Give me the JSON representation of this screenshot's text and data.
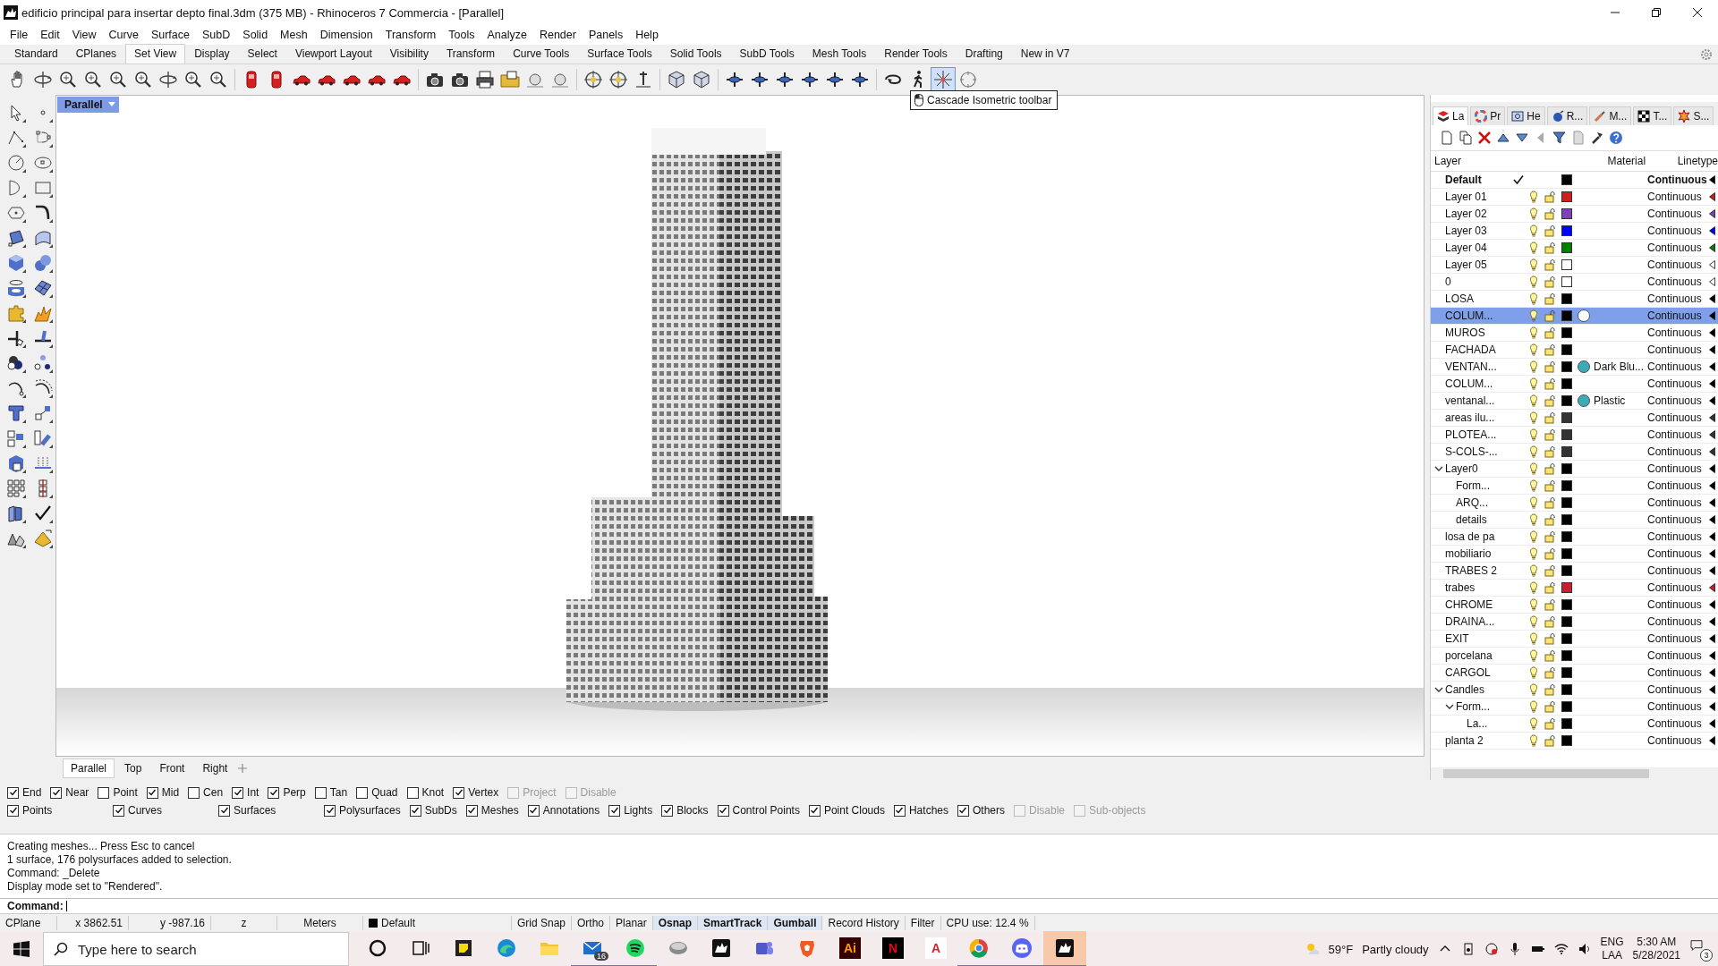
{
  "window": {
    "title": "edificio principal para insertar depto final.3dm (375 MB) - Rhinoceros 7 Commercia - [Parallel]"
  },
  "menu": [
    "File",
    "Edit",
    "View",
    "Curve",
    "Surface",
    "SubD",
    "Solid",
    "Mesh",
    "Dimension",
    "Transform",
    "Tools",
    "Analyze",
    "Render",
    "Panels",
    "Help"
  ],
  "toolbar_tabs": [
    {
      "label": "Standard",
      "selected": false
    },
    {
      "label": "CPlanes",
      "selected": false
    },
    {
      "label": "Set View",
      "selected": true
    },
    {
      "label": "Display",
      "selected": false
    },
    {
      "label": "Select",
      "selected": false
    },
    {
      "label": "Viewport Layout",
      "selected": false
    },
    {
      "label": "Visibility",
      "selected": false
    },
    {
      "label": "Transform",
      "selected": false
    },
    {
      "label": "Curve Tools",
      "selected": false
    },
    {
      "label": "Surface Tools",
      "selected": false
    },
    {
      "label": "Solid Tools",
      "selected": false
    },
    {
      "label": "SubD Tools",
      "selected": false
    },
    {
      "label": "Mesh Tools",
      "selected": false
    },
    {
      "label": "Render Tools",
      "selected": false
    },
    {
      "label": "Drafting",
      "selected": false
    },
    {
      "label": "New in V7",
      "selected": false
    }
  ],
  "toolbar": {
    "buttons": [
      {
        "kind": "hand",
        "selected": false
      },
      {
        "kind": "rotate",
        "selected": false
      },
      {
        "kind": "zoom",
        "selected": false
      },
      {
        "kind": "zoom",
        "selected": false
      },
      {
        "kind": "zoom",
        "selected": false
      },
      {
        "kind": "zoom",
        "selected": false
      },
      {
        "kind": "rotate",
        "selected": false
      },
      {
        "kind": "zoom",
        "selected": false
      },
      {
        "kind": "zoom",
        "selected": false
      },
      {
        "kind": "sep"
      },
      {
        "kind": "red",
        "selected": false
      },
      {
        "kind": "red",
        "selected": false
      },
      {
        "kind": "car",
        "selected": false
      },
      {
        "kind": "car",
        "selected": false
      },
      {
        "kind": "car",
        "selected": false
      },
      {
        "kind": "car",
        "selected": false
      },
      {
        "kind": "car",
        "selected": false
      },
      {
        "kind": "sep"
      },
      {
        "kind": "camera",
        "selected": false
      },
      {
        "kind": "camera",
        "selected": false
      },
      {
        "kind": "printer",
        "selected": false
      },
      {
        "kind": "folder",
        "selected": false
      },
      {
        "kind": "sphere",
        "selected": false
      },
      {
        "kind": "sphere",
        "selected": false
      },
      {
        "kind": "sep"
      },
      {
        "kind": "target",
        "selected": false
      },
      {
        "kind": "target",
        "selected": false
      },
      {
        "kind": "pin",
        "selected": false
      },
      {
        "kind": "sep"
      },
      {
        "kind": "box",
        "selected": false
      },
      {
        "kind": "box",
        "selected": false
      },
      {
        "kind": "sep"
      },
      {
        "kind": "plane",
        "selected": false
      },
      {
        "kind": "plane",
        "selected": false
      },
      {
        "kind": "plane",
        "selected": false
      },
      {
        "kind": "plane",
        "selected": false
      },
      {
        "kind": "plane",
        "selected": false
      },
      {
        "kind": "plane",
        "selected": false
      },
      {
        "kind": "sep"
      },
      {
        "kind": "loop",
        "selected": false
      },
      {
        "kind": "walk",
        "selected": false
      },
      {
        "kind": "iso",
        "selected": true
      },
      {
        "kind": "dial",
        "selected": false
      }
    ]
  },
  "tooltip": "Cascade Isometric toolbar",
  "viewport": {
    "label": "Parallel",
    "tabs": [
      {
        "label": "Parallel",
        "selected": true
      },
      {
        "label": "Top",
        "selected": false
      },
      {
        "label": "Front",
        "selected": false
      },
      {
        "label": "Right",
        "selected": false
      }
    ]
  },
  "layers_panel": {
    "tabs": [
      {
        "label": "La",
        "kind": "layers",
        "selected": true
      },
      {
        "label": "Pr",
        "kind": "properties",
        "selected": false
      },
      {
        "label": "He",
        "kind": "help",
        "selected": false
      },
      {
        "label": "R...",
        "kind": "render",
        "selected": false
      },
      {
        "label": "M...",
        "kind": "materials",
        "selected": false
      },
      {
        "label": "T...",
        "kind": "textures",
        "selected": false
      },
      {
        "label": "S...",
        "kind": "sun",
        "selected": false
      }
    ],
    "columns": [
      "Layer",
      "Material",
      "Linetype"
    ],
    "layers": [
      {
        "name": "Default",
        "current": true,
        "selected": false,
        "color": "#000000",
        "linetype": "Continuous"
      },
      {
        "name": "Layer 01",
        "current": false,
        "selected": false,
        "color": "#cc1f1f",
        "linetype": "Continuous"
      },
      {
        "name": "Layer 02",
        "current": false,
        "selected": false,
        "color": "#7f3fbf",
        "linetype": "Continuous"
      },
      {
        "name": "Layer 03",
        "current": false,
        "selected": false,
        "color": "#0000ff",
        "linetype": "Continuous"
      },
      {
        "name": "Layer 04",
        "current": false,
        "selected": false,
        "color": "#007f00",
        "linetype": "Continuous"
      },
      {
        "name": "Layer 05",
        "current": false,
        "selected": false,
        "color": "#ffffff",
        "linetype": "Continuous"
      },
      {
        "name": "0",
        "current": false,
        "selected": false,
        "color": "#ffffff",
        "linetype": "Continuous"
      },
      {
        "name": "LOSA",
        "current": false,
        "selected": false,
        "color": "#000000",
        "linetype": "Continuous"
      },
      {
        "name": "COLUM...",
        "current": false,
        "selected": true,
        "color": "#000000",
        "material": {
          "color": "#ffffff"
        },
        "linetype": "Continuous"
      },
      {
        "name": "MUROS",
        "current": false,
        "selected": false,
        "color": "#000000",
        "linetype": "Continuous"
      },
      {
        "name": "FACHADA",
        "current": false,
        "selected": false,
        "color": "#000000",
        "linetype": "Continuous"
      },
      {
        "name": "VENTAN...",
        "current": false,
        "selected": false,
        "color": "#000000",
        "material": {
          "name": "Dark Blu...",
          "color": "#3fa9b5"
        },
        "linetype": "Continuous"
      },
      {
        "name": "COLUM...",
        "current": false,
        "selected": false,
        "color": "#000000",
        "linetype": "Continuous"
      },
      {
        "name": "ventanal...",
        "current": false,
        "selected": false,
        "color": "#000000",
        "material": {
          "name": "Plastic",
          "color": "#3fa9b5"
        },
        "linetype": "Continuous"
      },
      {
        "name": "areas ilu...",
        "current": false,
        "selected": false,
        "color": "#333333",
        "linetype": "Continuous"
      },
      {
        "name": "PLOTEA...",
        "current": false,
        "selected": false,
        "color": "#333333",
        "linetype": "Continuous"
      },
      {
        "name": "S-COLS-...",
        "current": false,
        "selected": false,
        "color": "#333333",
        "linetype": "Continuous"
      },
      {
        "name": "Layer0",
        "current": false,
        "selected": false,
        "color": "#000000",
        "linetype": "Continuous",
        "expanded": true,
        "children": [
          {
            "name": "Form...",
            "current": false,
            "selected": false,
            "color": "#000000",
            "linetype": "Continuous"
          },
          {
            "name": "ARQ...",
            "current": false,
            "selected": false,
            "color": "#000000",
            "linetype": "Continuous"
          },
          {
            "name": "details",
            "current": false,
            "selected": false,
            "color": "#000000",
            "linetype": "Continuous"
          }
        ]
      },
      {
        "name": "losa de pa",
        "current": false,
        "selected": false,
        "color": "#000000",
        "linetype": "Continuous"
      },
      {
        "name": "mobiliario",
        "current": false,
        "selected": false,
        "color": "#000000",
        "linetype": "Continuous"
      },
      {
        "name": "TRABES 2",
        "current": false,
        "selected": false,
        "color": "#000000",
        "linetype": "Continuous"
      },
      {
        "name": "trabes",
        "current": false,
        "selected": false,
        "color": "#c81e32",
        "linetype": "Continuous"
      },
      {
        "name": "CHROME",
        "current": false,
        "selected": false,
        "color": "#000000",
        "linetype": "Continuous"
      },
      {
        "name": "DRAINA...",
        "current": false,
        "selected": false,
        "color": "#000000",
        "linetype": "Continuous"
      },
      {
        "name": "EXIT",
        "current": false,
        "selected": false,
        "color": "#000000",
        "linetype": "Continuous"
      },
      {
        "name": "porcelana",
        "current": false,
        "selected": false,
        "color": "#000000",
        "linetype": "Continuous"
      },
      {
        "name": "CARGOL",
        "current": false,
        "selected": false,
        "color": "#000000",
        "linetype": "Continuous"
      },
      {
        "name": "Candles",
        "current": false,
        "selected": false,
        "color": "#000000",
        "linetype": "Continuous",
        "expanded": true,
        "children": [
          {
            "name": "Form...",
            "current": false,
            "selected": false,
            "color": "#000000",
            "linetype": "Continuous",
            "expanded": true,
            "children": [
              {
                "name": "La...",
                "current": false,
                "selected": false,
                "color": "#000000",
                "linetype": "Continuous"
              }
            ]
          }
        ]
      },
      {
        "name": "planta 2",
        "current": false,
        "selected": false,
        "color": "#000000",
        "linetype": "Continuous"
      }
    ]
  },
  "osnaps": [
    {
      "label": "End",
      "checked": true,
      "disabled": false
    },
    {
      "label": "Near",
      "checked": true,
      "disabled": false
    },
    {
      "label": "Point",
      "checked": false,
      "disabled": false
    },
    {
      "label": "Mid",
      "checked": true,
      "disabled": false
    },
    {
      "label": "Cen",
      "checked": false,
      "disabled": false
    },
    {
      "label": "Int",
      "checked": true,
      "disabled": false
    },
    {
      "label": "Perp",
      "checked": true,
      "disabled": false
    },
    {
      "label": "Tan",
      "checked": false,
      "disabled": false
    },
    {
      "label": "Quad",
      "checked": false,
      "disabled": false
    },
    {
      "label": "Knot",
      "checked": false,
      "disabled": false
    },
    {
      "label": "Vertex",
      "checked": true,
      "disabled": false
    },
    {
      "label": "Project",
      "checked": false,
      "disabled": true
    },
    {
      "label": "Disable",
      "checked": false,
      "disabled": true
    }
  ],
  "filters": [
    {
      "label": "Points",
      "checked": true,
      "disabled": false
    },
    {
      "label": "Curves",
      "checked": true,
      "disabled": false
    },
    {
      "label": "Surfaces",
      "checked": true,
      "disabled": false
    },
    {
      "label": "Polysurfaces",
      "checked": true,
      "disabled": false
    },
    {
      "label": "SubDs",
      "checked": true,
      "disabled": false
    },
    {
      "label": "Meshes",
      "checked": true,
      "disabled": false
    },
    {
      "label": "Annotations",
      "checked": true,
      "disabled": false
    },
    {
      "label": "Lights",
      "checked": true,
      "disabled": false
    },
    {
      "label": "Blocks",
      "checked": true,
      "disabled": false
    },
    {
      "label": "Control Points",
      "checked": true,
      "disabled": false
    },
    {
      "label": "Point Clouds",
      "checked": true,
      "disabled": false
    },
    {
      "label": "Hatches",
      "checked": true,
      "disabled": false
    },
    {
      "label": "Others",
      "checked": true,
      "disabled": false
    },
    {
      "label": "Disable",
      "checked": false,
      "disabled": true
    },
    {
      "label": "Sub-objects",
      "checked": false,
      "disabled": true
    }
  ],
  "command": {
    "history": [
      "Creating meshes... Press Esc to cancel",
      "1 surface, 176 polysurfaces added to selection.",
      "Command: _Delete",
      "Display mode set to \"Rendered\"."
    ],
    "prompt": "Command:"
  },
  "status_bar": {
    "cplane": "CPlane",
    "x": "x 3862.51",
    "y": "y -987.16",
    "z": "z",
    "units": "Meters",
    "layer": "Default",
    "toggles": [
      {
        "label": "Grid Snap",
        "on": false
      },
      {
        "label": "Ortho",
        "on": false
      },
      {
        "label": "Planar",
        "on": false
      },
      {
        "label": "Osnap",
        "on": true
      },
      {
        "label": "SmartTrack",
        "on": true
      },
      {
        "label": "Gumball",
        "on": true
      },
      {
        "label": "Record History",
        "on": false
      },
      {
        "label": "Filter",
        "on": false
      }
    ],
    "cpu": "CPU use: 12.4 %"
  },
  "taskbar": {
    "search": {
      "placeholder": "Type here to search"
    },
    "apps": [
      {
        "kind": "cortana",
        "running": false,
        "selected": false
      },
      {
        "kind": "taskview",
        "running": false,
        "selected": false
      },
      {
        "kind": "notes",
        "running": false,
        "selected": false
      },
      {
        "kind": "browser",
        "running": false,
        "selected": false
      },
      {
        "kind": "folder",
        "running": false,
        "selected": false
      },
      {
        "kind": "mail",
        "badge": "16",
        "running": true,
        "selected": false
      },
      {
        "kind": "music",
        "running": true,
        "selected": false
      },
      {
        "kind": "disk",
        "running": false,
        "selected": false
      },
      {
        "kind": "rhino",
        "running": false,
        "selected": false
      },
      {
        "kind": "team",
        "running": false,
        "selected": false
      },
      {
        "kind": "lion",
        "running": false,
        "selected": false
      },
      {
        "kind": "tile",
        "label": "Ai",
        "running": false,
        "selected": false
      },
      {
        "kind": "tile",
        "label": "N",
        "running": false,
        "selected": false
      },
      {
        "kind": "tile",
        "label": "A",
        "running": false,
        "selected": false
      },
      {
        "kind": "chrome",
        "running": true,
        "selected": false
      },
      {
        "kind": "chat",
        "running": true,
        "selected": false
      },
      {
        "kind": "rhino",
        "running": true,
        "selected": true
      }
    ],
    "weather": {
      "temp": "59°F",
      "condition": "Partly cloudy"
    },
    "language": [
      "ENG",
      "LAA"
    ],
    "time": "5:30 AM",
    "date": "5/28/2021",
    "notifications": "3"
  }
}
